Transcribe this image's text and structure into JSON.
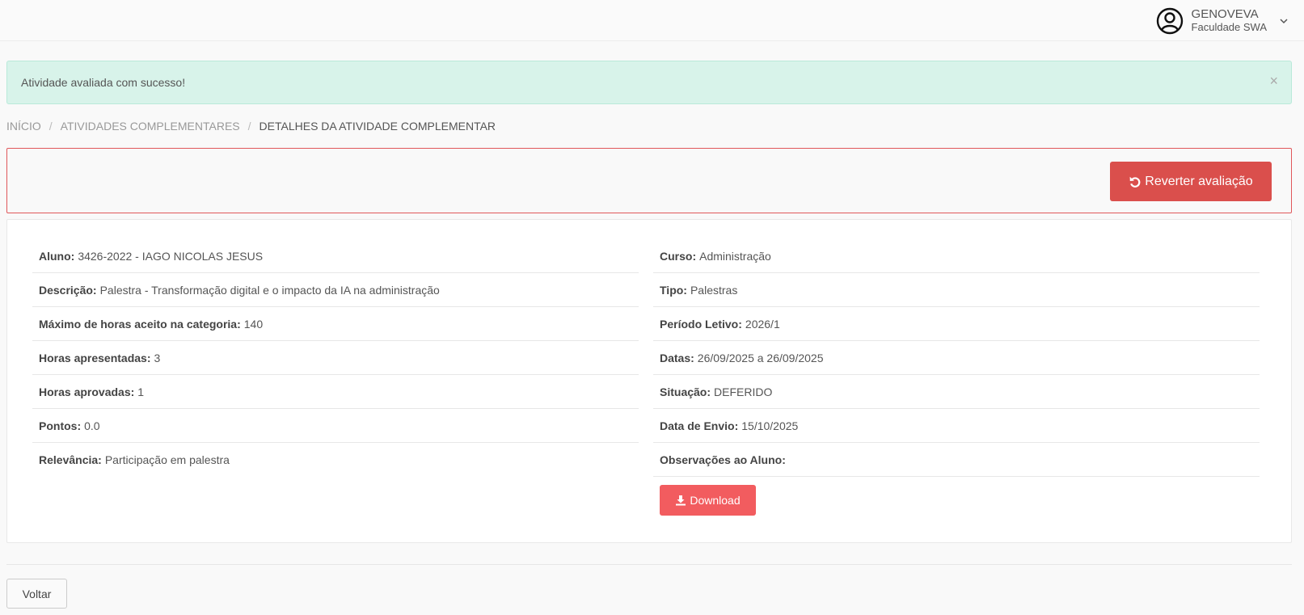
{
  "user": {
    "name": "GENOVEVA",
    "org": "Faculdade SWA"
  },
  "alert": {
    "message": "Atividade avaliada com sucesso!",
    "close": "×"
  },
  "breadcrumb": [
    {
      "label": "INÍCIO"
    },
    {
      "label": "ATIVIDADES COMPLEMENTARES"
    },
    {
      "label": "DETALHES DA ATIVIDADE COMPLEMENTAR"
    }
  ],
  "breadcrumb_sep": "/",
  "actions": {
    "revert_label": "Reverter avaliação"
  },
  "left": [
    {
      "label": "Aluno:",
      "value": "3426-2022 - IAGO NICOLAS JESUS"
    },
    {
      "label": "Descrição:",
      "value": "Palestra - Transformação digital e o impacto da IA na administração"
    },
    {
      "label": "Máximo de horas aceito na categoria:",
      "value": "140"
    },
    {
      "label": "Horas apresentadas:",
      "value": "3"
    },
    {
      "label": "Horas aprovadas:",
      "value": "1"
    },
    {
      "label": "Pontos:",
      "value": "0.0"
    },
    {
      "label": "Relevância:",
      "value": "Participação em palestra"
    }
  ],
  "right": [
    {
      "label": "Curso:",
      "value": "Administração"
    },
    {
      "label": "Tipo:",
      "value": "Palestras"
    },
    {
      "label": "Período Letivo:",
      "value": "2026/1"
    },
    {
      "label": "Datas:",
      "value": "26/09/2025 a 26/09/2025"
    },
    {
      "label": "Situação:",
      "value": "DEFERIDO"
    },
    {
      "label": "Data de Envio:",
      "value": "15/10/2025"
    },
    {
      "label": "Observações ao Aluno:",
      "value": ""
    }
  ],
  "download_label": "Download",
  "back_label": "Voltar",
  "colors": {
    "success_bg": "#d8f3ea",
    "danger": "#da4f4c",
    "download": "#f25c5f"
  },
  "icons": {
    "user": "user-circle-icon",
    "chevron": "chevron-down-icon",
    "revert": "undo-icon",
    "download": "download-icon",
    "close": "close-icon"
  }
}
